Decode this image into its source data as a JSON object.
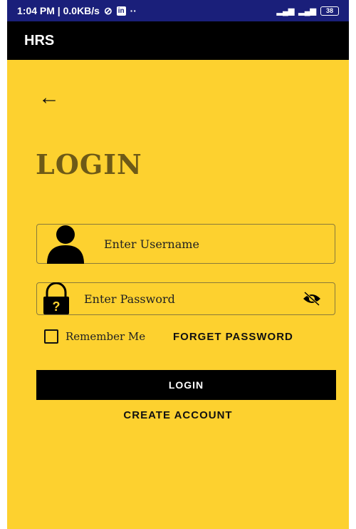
{
  "status_bar": {
    "time_speed": "1:04 PM | 0.0KB/s",
    "notification_badge": "in",
    "battery": "38"
  },
  "app_bar": {
    "title": "HRS"
  },
  "back_glyph": "←",
  "login_title": "LOGIN",
  "username": {
    "placeholder": "Enter Username",
    "value": ""
  },
  "password": {
    "placeholder": "Enter Password",
    "value": ""
  },
  "remember_me": {
    "label": "Remember Me",
    "checked": false
  },
  "forget_password_label": "FORGET PASSWORD",
  "login_button_label": "LOGIN",
  "create_account_label": "CREATE ACCOUNT",
  "colors": {
    "background": "#fdd12f",
    "status_bar": "#1a1f7a",
    "app_bar": "#000000",
    "title": "#6e5a17",
    "button": "#000000"
  },
  "icons": [
    "user-icon",
    "lock-icon",
    "eye-off-icon",
    "back-arrow-icon"
  ]
}
